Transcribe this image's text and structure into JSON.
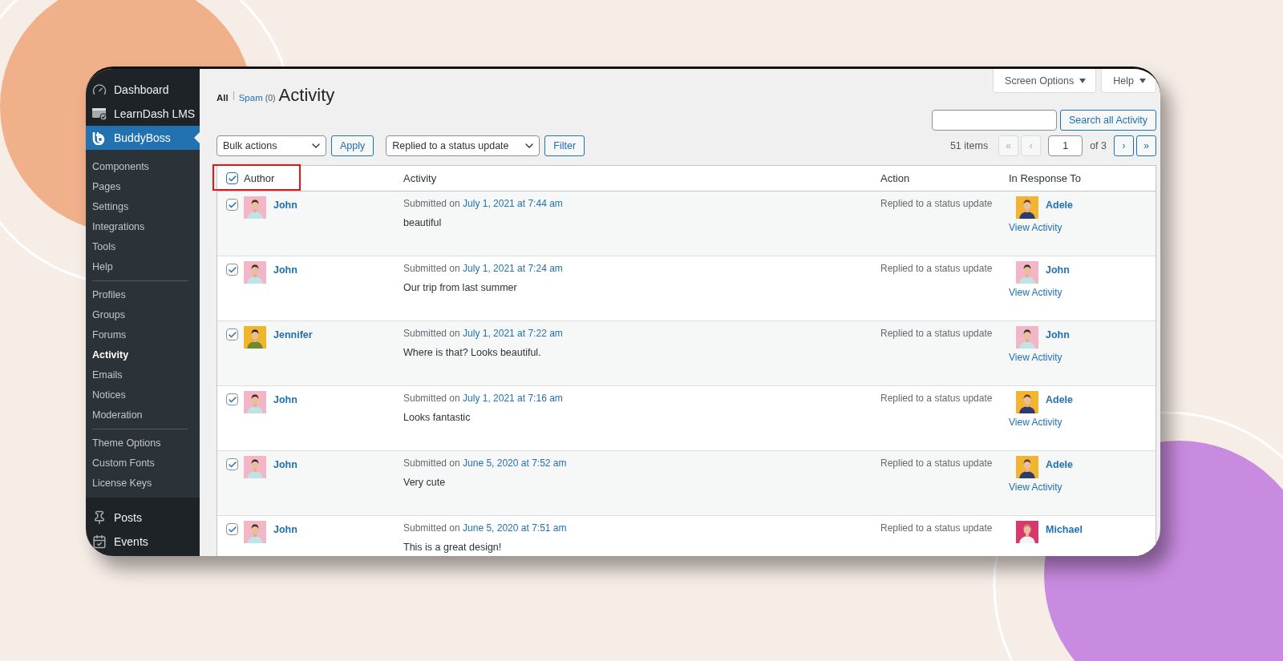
{
  "sidebar": {
    "menu": [
      {
        "label": "Dashboard",
        "selected": false
      },
      {
        "label": "LearnDash LMS",
        "selected": false
      },
      {
        "label": "BuddyBoss",
        "selected": true,
        "submenu_groups": [
          [
            {
              "label": "Components",
              "selected": false
            },
            {
              "label": "Pages",
              "selected": false
            },
            {
              "label": "Settings",
              "selected": false
            },
            {
              "label": "Integrations",
              "selected": false
            },
            {
              "label": "Tools",
              "selected": false
            },
            {
              "label": "Help",
              "selected": false
            }
          ],
          [
            {
              "label": "Profiles",
              "selected": false
            },
            {
              "label": "Groups",
              "selected": false
            },
            {
              "label": "Forums",
              "selected": false
            },
            {
              "label": "Activity",
              "selected": true
            },
            {
              "label": "Emails",
              "selected": false
            },
            {
              "label": "Notices",
              "selected": false
            },
            {
              "label": "Moderation",
              "selected": false
            }
          ],
          [
            {
              "label": "Theme Options",
              "selected": false
            },
            {
              "label": "Custom Fonts",
              "selected": false
            },
            {
              "label": "License Keys",
              "selected": false
            }
          ]
        ]
      },
      {
        "label": "Posts",
        "selected": false
      },
      {
        "label": "Events",
        "selected": false
      }
    ]
  },
  "screen_meta_buttons": [
    "Screen Options",
    "Help"
  ],
  "views": [
    {
      "label": "All",
      "selected": true
    },
    {
      "label": "Spam",
      "count": "(0)",
      "selected": false
    }
  ],
  "page_title": "Activity",
  "search": {
    "button": "Search all Activity"
  },
  "tablenav": {
    "bulk_select": "Bulk actions",
    "apply": "Apply",
    "filter_select": "Replied to a status update",
    "filter": "Filter"
  },
  "pagination": {
    "count": "51 items",
    "buttons_before": [
      {
        "label": "«",
        "disabled": true
      },
      {
        "label": "‹",
        "disabled": true
      }
    ],
    "page": "1",
    "of": "of 3",
    "buttons_after": [
      {
        "label": "›",
        "disabled": false
      },
      {
        "label": "»",
        "disabled": false
      }
    ]
  },
  "table": {
    "select_all": {
      "checked": true,
      "highlighted": true
    },
    "columns": [
      "Author",
      "Activity",
      "Action",
      "In Response To"
    ],
    "rows": [
      {
        "checked": true,
        "author": "John",
        "submitted": "Submitted on",
        "date": "July 1, 2021 at 7:44 am",
        "content": "beautiful",
        "action": "Replied to a status update",
        "response": {
          "name": "Adele",
          "link": "View Activity"
        }
      },
      {
        "checked": true,
        "author": "John",
        "submitted": "Submitted on",
        "date": "July 1, 2021 at 7:24 am",
        "content": "Our trip from last summer",
        "action": "Replied to a status update",
        "response": {
          "name": "John",
          "link": "View Activity"
        }
      },
      {
        "checked": true,
        "author": "Jennifer",
        "submitted": "Submitted on",
        "date": "July 1, 2021 at 7:22 am",
        "content": "Where is that? Looks beautiful.",
        "action": "Replied to a status update",
        "response": {
          "name": "John",
          "link": "View Activity"
        }
      },
      {
        "checked": true,
        "author": "John",
        "submitted": "Submitted on",
        "date": "July 1, 2021 at 7:16 am",
        "content": "Looks fantastic",
        "action": "Replied to a status update",
        "response": {
          "name": "Adele",
          "link": "View Activity"
        }
      },
      {
        "checked": true,
        "author": "John",
        "submitted": "Submitted on",
        "date": "June 5, 2020 at 7:52 am",
        "content": "Very cute",
        "action": "Replied to a status update",
        "response": {
          "name": "Adele",
          "link": "View Activity"
        }
      },
      {
        "checked": true,
        "author": "John",
        "submitted": "Submitted on",
        "date": "June 5, 2020 at 7:51 am",
        "content": "This is a great design!",
        "action": "Replied to a status update",
        "response": {
          "name": "Michael"
        }
      }
    ]
  }
}
